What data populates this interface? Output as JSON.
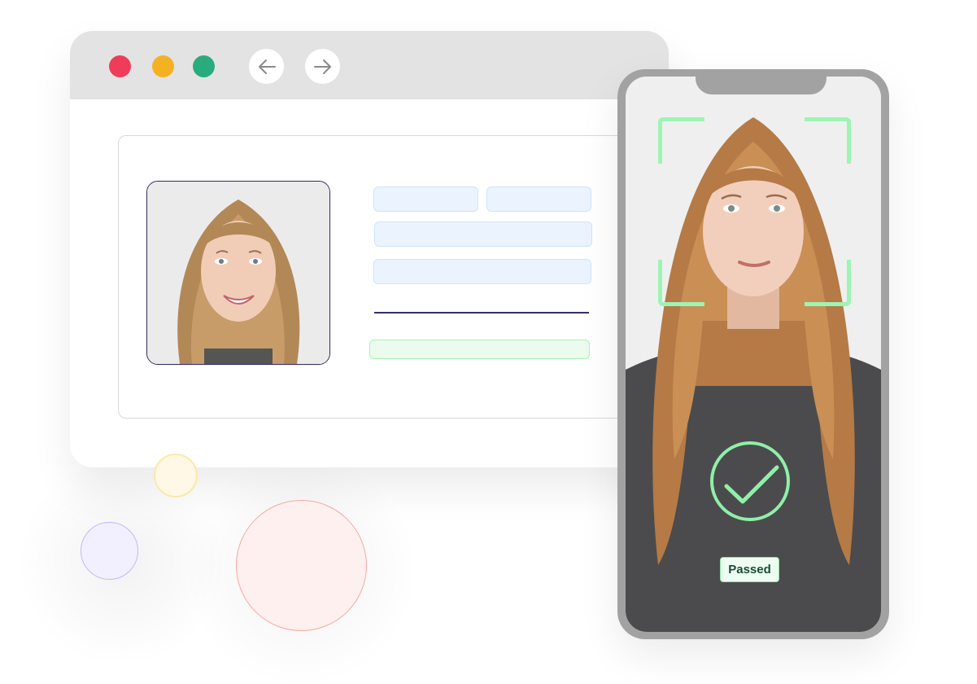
{
  "browser": {
    "window_controls": [
      {
        "name": "close",
        "color": "#ef3d59"
      },
      {
        "name": "minimize",
        "color": "#f4b223"
      },
      {
        "name": "maximize",
        "color": "#2aab7d"
      }
    ],
    "nav": {
      "back_icon": "arrow-left-icon",
      "forward_icon": "arrow-right-icon"
    }
  },
  "id_card": {
    "photo_subject": "smiling woman with long light-brown hair",
    "fields": [
      "placeholder-1a",
      "placeholder-1b",
      "placeholder-2",
      "placeholder-3"
    ],
    "status_bar_color": "#ebfcef"
  },
  "phone": {
    "scan_frame_color": "#9cf5b3",
    "photo_subject": "woman with long wavy hair in grey t-shirt",
    "result_icon": "check-circle-icon",
    "result_label": "Passed"
  },
  "decorations": {
    "circles": [
      {
        "color": "#fff8e6",
        "border": "#fde8a9"
      },
      {
        "color": "#f2f0ff",
        "border": "#bfb8fb"
      },
      {
        "color": "#fff0f0",
        "border": "#f3aaa0"
      }
    ]
  }
}
